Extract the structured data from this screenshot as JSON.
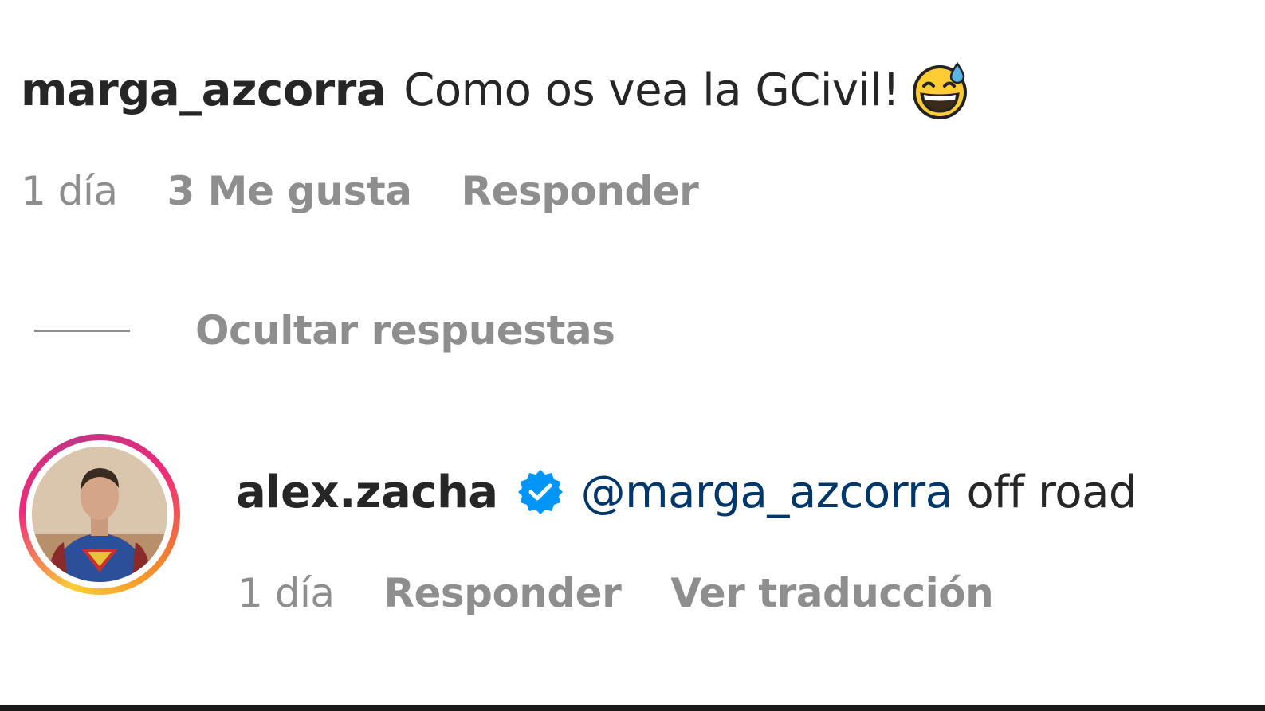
{
  "parent_comment": {
    "username": "marga_azcorra",
    "text": "Como os vea la GCivil!",
    "emoji": "grinning-face-with-sweat",
    "time": "1 día",
    "likes": "3 Me gusta",
    "reply_label": "Responder"
  },
  "replies_toggle": {
    "label": "Ocultar respuestas"
  },
  "reply": {
    "username": "alex.zacha",
    "verified": true,
    "mention": "@marga_azcorra",
    "text": "off road",
    "time": "1 día",
    "reply_label": "Responder",
    "translate_label": "Ver traducción"
  },
  "colors": {
    "text_primary": "#262626",
    "text_secondary": "#8e8e8e",
    "mention": "#00376b",
    "verified_badge": "#0095f6"
  }
}
